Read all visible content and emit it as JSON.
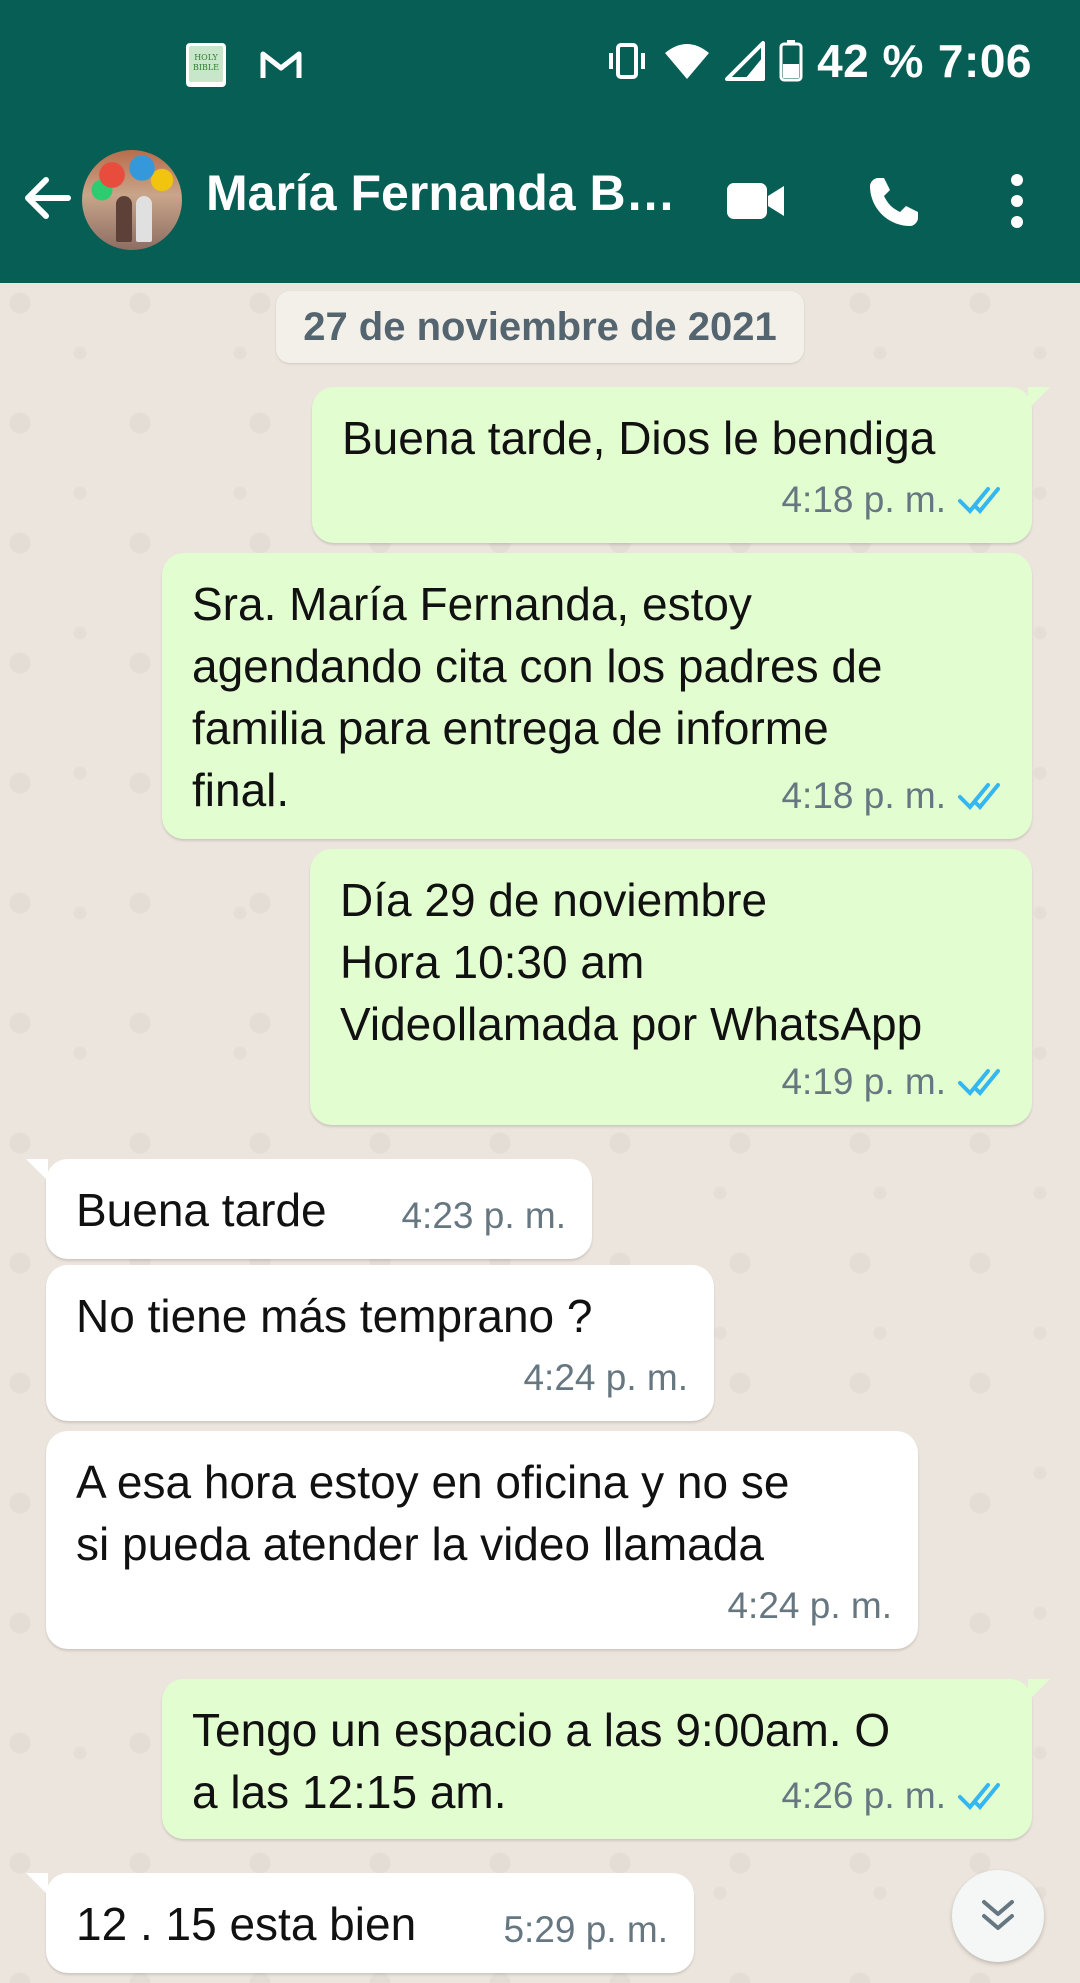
{
  "status_bar": {
    "battery": "42 %",
    "time": "7:06",
    "icons": [
      "bible-app-icon",
      "gmail-icon",
      "vibrate-icon",
      "wifi-icon",
      "signal-icon",
      "battery-icon"
    ]
  },
  "header": {
    "contact_name": "María Fernanda Bu...",
    "icons": [
      "back-arrow-icon",
      "video-call-icon",
      "phone-icon",
      "more-options-icon"
    ],
    "color": "#075e54"
  },
  "chat": {
    "date_separator": "27 de noviembre de 2021",
    "messages": [
      {
        "direction": "out",
        "text": "Buena tarde, Dios le bendiga",
        "time": "4:18 p. m.",
        "read": true
      },
      {
        "direction": "out",
        "text": "Sra. María Fernanda, estoy\nagendando cita con los padres de\nfamilia para entrega de informe\nfinal.",
        "time": "4:18 p. m.",
        "read": true
      },
      {
        "direction": "out",
        "text": "Día 29 de noviembre\nHora 10:30 am\nVideollamada por WhatsApp",
        "time": "4:19 p. m.",
        "read": true
      },
      {
        "direction": "in",
        "text": "Buena tarde",
        "time": "4:23 p. m."
      },
      {
        "direction": "in",
        "text": "No tiene más temprano   ?",
        "time": "4:24 p. m."
      },
      {
        "direction": "in",
        "text": "A esa hora estoy en oficina y no se\nsi pueda atender la video llamada",
        "time": "4:24 p. m."
      },
      {
        "direction": "out",
        "text": "Tengo un espacio a las 9:00am. O\na las 12:15 am.",
        "time": "4:26 p. m.",
        "read": true
      },
      {
        "direction": "in",
        "text": "12 . 15 esta bien",
        "time": "5:29 p. m."
      }
    ],
    "colors": {
      "outgoing_bubble": "#e2fdd0",
      "incoming_bubble": "#ffffff",
      "read_tick": "#34b7f1"
    }
  }
}
